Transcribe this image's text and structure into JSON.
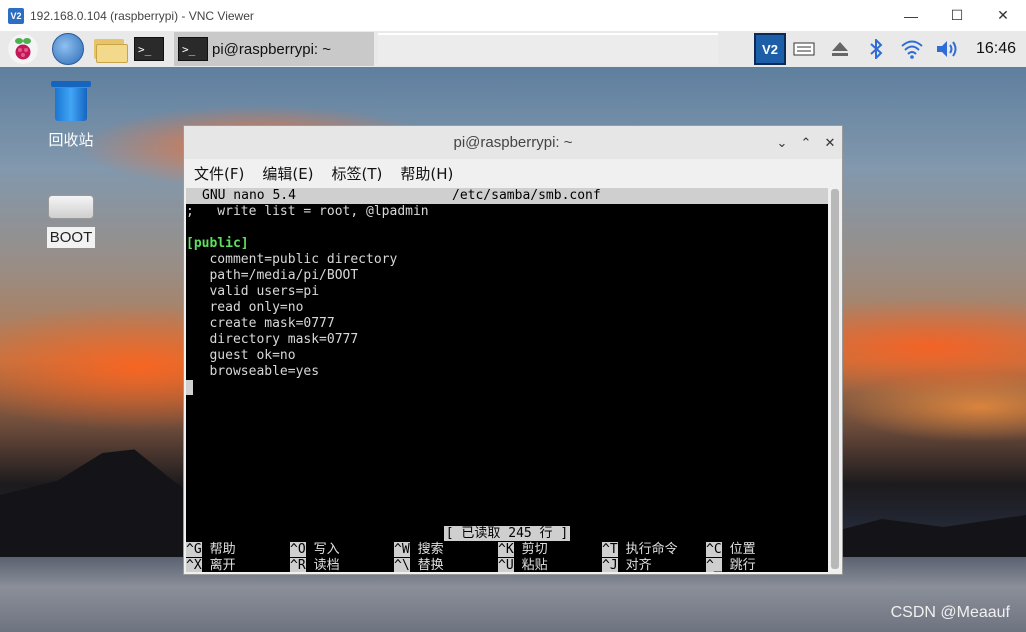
{
  "vnc_window": {
    "logo_text": "V2",
    "title": "192.168.0.104 (raspberrypi) - VNC Viewer",
    "minimize": "—",
    "maximize": "☐",
    "close": "✕"
  },
  "panel": {
    "task_label": "pi@raspberrypi: ~",
    "terminal_glyph": ">_",
    "vnc_tray_text": "V2",
    "clock": "16:46"
  },
  "desktop": {
    "trash_label": "回收站",
    "boot_label": "BOOT"
  },
  "terminal": {
    "title": "pi@raspberrypi: ~",
    "minimize": "⌄",
    "maximize": "⌃",
    "close": "✕",
    "menus": [
      "文件(F)",
      "编辑(E)",
      "标签(T)",
      "帮助(H)"
    ]
  },
  "nano": {
    "version": "GNU nano 5.4",
    "file": "/etc/samba/smb.conf",
    "lines": [
      ";   write list = root, @lpadmin",
      "",
      "[public]",
      "   comment=public directory",
      "   path=/media/pi/BOOT",
      "   valid users=pi",
      "   read only=no",
      "   create mask=0777",
      "   directory mask=0777",
      "   guest ok=no",
      "   browseable=yes"
    ],
    "status": "[ 已读取 245 行 ]",
    "shortcuts_row1": [
      {
        "key": "^G",
        "label": "帮助"
      },
      {
        "key": "^O",
        "label": "写入"
      },
      {
        "key": "^W",
        "label": "搜索"
      },
      {
        "key": "^K",
        "label": "剪切"
      },
      {
        "key": "^T",
        "label": "执行命令"
      },
      {
        "key": "^C",
        "label": "位置"
      }
    ],
    "shortcuts_row2": [
      {
        "key": "^X",
        "label": "离开"
      },
      {
        "key": "^R",
        "label": "读档"
      },
      {
        "key": "^\\",
        "label": "替换"
      },
      {
        "key": "^U",
        "label": "粘贴"
      },
      {
        "key": "^J",
        "label": "对齐"
      },
      {
        "key": "^_",
        "label": "跳行"
      }
    ]
  },
  "watermark": "CSDN @Meaauf"
}
